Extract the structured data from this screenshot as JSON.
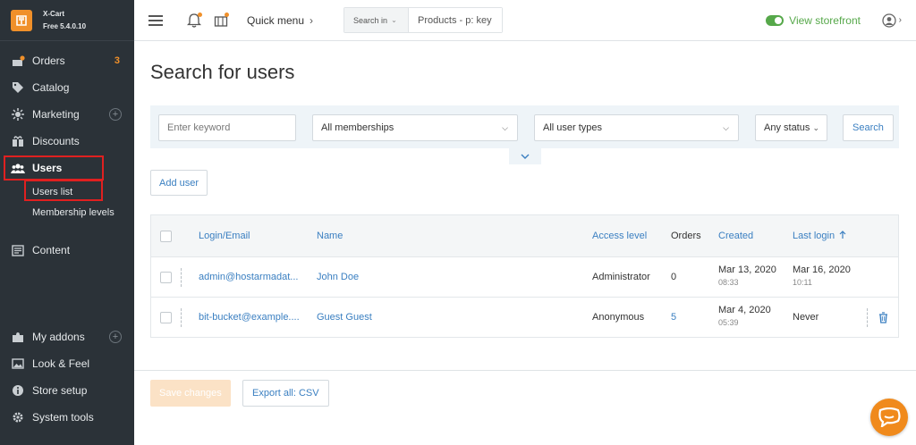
{
  "brand": {
    "name": "X-Cart",
    "version": "Free 5.4.0.10",
    "color": "#f0902a"
  },
  "sidebar": {
    "items": [
      {
        "label": "Orders",
        "icon": "orders-icon",
        "badge": "3"
      },
      {
        "label": "Catalog",
        "icon": "tag-icon"
      },
      {
        "label": "Marketing",
        "icon": "marketing-icon"
      },
      {
        "label": "Discounts",
        "icon": "gift-icon"
      },
      {
        "label": "Users",
        "icon": "users-icon"
      },
      {
        "label": "Content",
        "icon": "content-icon"
      },
      {
        "label": "My addons",
        "icon": "puzzle-icon"
      },
      {
        "label": "Look & Feel",
        "icon": "image-icon"
      },
      {
        "label": "Store setup",
        "icon": "info-icon"
      },
      {
        "label": "System tools",
        "icon": "gear-icon"
      }
    ],
    "users_sub": [
      {
        "label": "Users list"
      },
      {
        "label": "Membership levels"
      }
    ]
  },
  "header": {
    "quick_menu": "Quick menu",
    "search_in": "Search in",
    "search_placeholder": "Products - p: key",
    "view_storefront": "View storefront"
  },
  "page": {
    "title": "Search for users"
  },
  "filters": {
    "keyword_placeholder": "Enter keyword",
    "membership": "All memberships",
    "user_type": "All user types",
    "status": "Any status",
    "search_label": "Search"
  },
  "actions": {
    "add_user": "Add user",
    "save_changes": "Save changes",
    "export_csv": "Export all: CSV"
  },
  "table": {
    "columns": {
      "login": "Login/Email",
      "name": "Name",
      "access": "Access level",
      "orders": "Orders",
      "created": "Created",
      "last_login": "Last login"
    },
    "rows": [
      {
        "login": "admin@hostarmadat...",
        "name": "John Doe",
        "access": "Administrator",
        "orders": "0",
        "created_date": "Mar 13, 2020",
        "created_time": "08:33",
        "last_login_date": "Mar 16, 2020",
        "last_login_time": "10:11"
      },
      {
        "login": "bit-bucket@example....",
        "name": "Guest Guest",
        "access": "Anonymous",
        "orders": "5",
        "created_date": "Mar 4, 2020",
        "created_time": "05:39",
        "last_login_date": "Never",
        "last_login_time": ""
      }
    ]
  },
  "colors": {
    "accent": "#3a7fc1",
    "orange": "#f0902a",
    "storefront_green": "#56a84a",
    "highlight_red": "#e02020"
  }
}
